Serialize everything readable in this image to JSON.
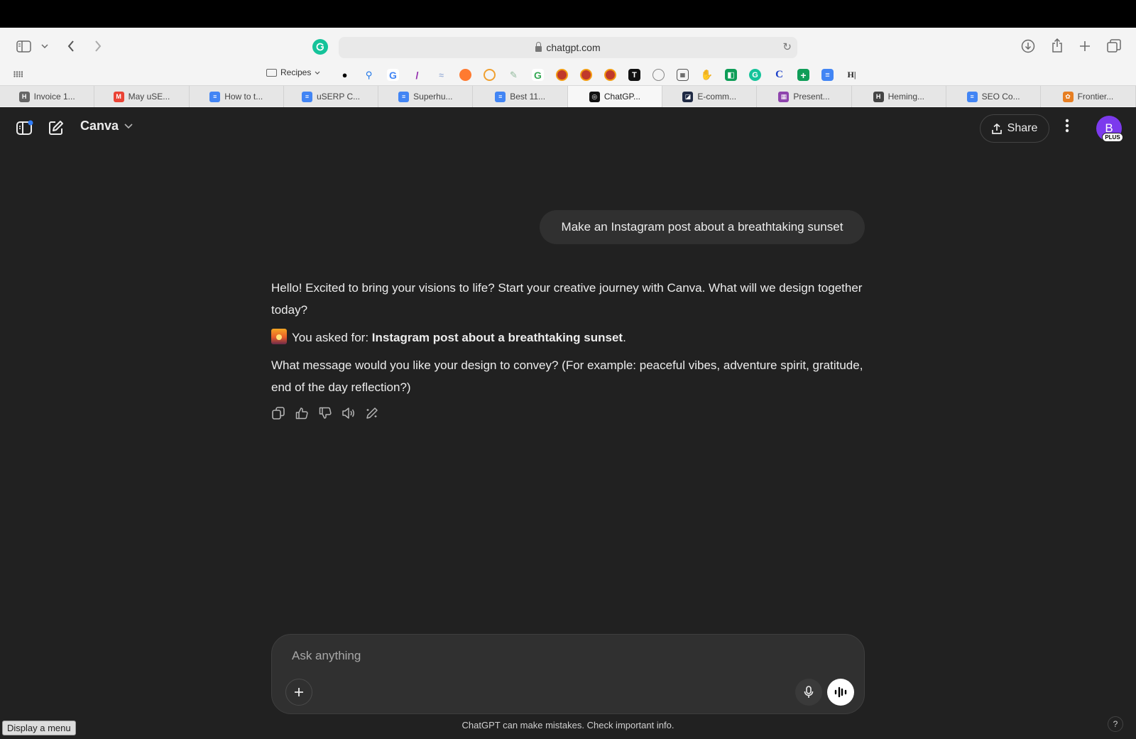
{
  "browser": {
    "url": "chatgpt.com",
    "bookmarks_folder": "Recipes",
    "favicon_letters": [
      "G",
      "T",
      "C",
      "H|"
    ],
    "tabs": [
      {
        "label": "Invoice 1...",
        "icon": "H",
        "color": "#666666"
      },
      {
        "label": "May uSE...",
        "icon": "M",
        "color": "#ea4335"
      },
      {
        "label": "How to t...",
        "icon": "≡",
        "color": "#4285f4"
      },
      {
        "label": "uSERP C...",
        "icon": "≡",
        "color": "#4285f4"
      },
      {
        "label": "Superhu...",
        "icon": "≡",
        "color": "#4285f4"
      },
      {
        "label": "Best 11...",
        "icon": "≡",
        "color": "#4285f4"
      },
      {
        "label": "ChatGP...",
        "icon": "◎",
        "color": "#111111"
      },
      {
        "label": "E-comm...",
        "icon": "◪",
        "color": "#1f2a44"
      },
      {
        "label": "Present...",
        "icon": "▦",
        "color": "#8e44ad"
      },
      {
        "label": "Heming...",
        "icon": "H",
        "color": "#444444"
      },
      {
        "label": "SEO Co...",
        "icon": "≡",
        "color": "#4285f4"
      },
      {
        "label": "Frontier...",
        "icon": "✿",
        "color": "#e67e22"
      }
    ]
  },
  "app": {
    "model_name": "Canva",
    "share_label": "Share",
    "avatar_letter": "B",
    "plan_badge": "PLUS"
  },
  "conversation": {
    "user_message": "Make an Instagram post about a breathtaking sunset",
    "assistant": {
      "greeting": "Hello! Excited to bring your visions to life? Start your creative journey with Canva. What will we design together today?",
      "asked_prefix": "You asked for: ",
      "asked_bold": "Instagram post about a breathtaking sunset",
      "asked_suffix": ".",
      "question": "What message would you like your design to convey? (For example: peaceful vibes, adventure spirit, gratitude, end of the day reflection?)"
    }
  },
  "composer": {
    "placeholder": "Ask anything"
  },
  "footer_note": "ChatGPT can make mistakes. Check important info.",
  "tooltip": "Display a menu",
  "help_label": "?"
}
